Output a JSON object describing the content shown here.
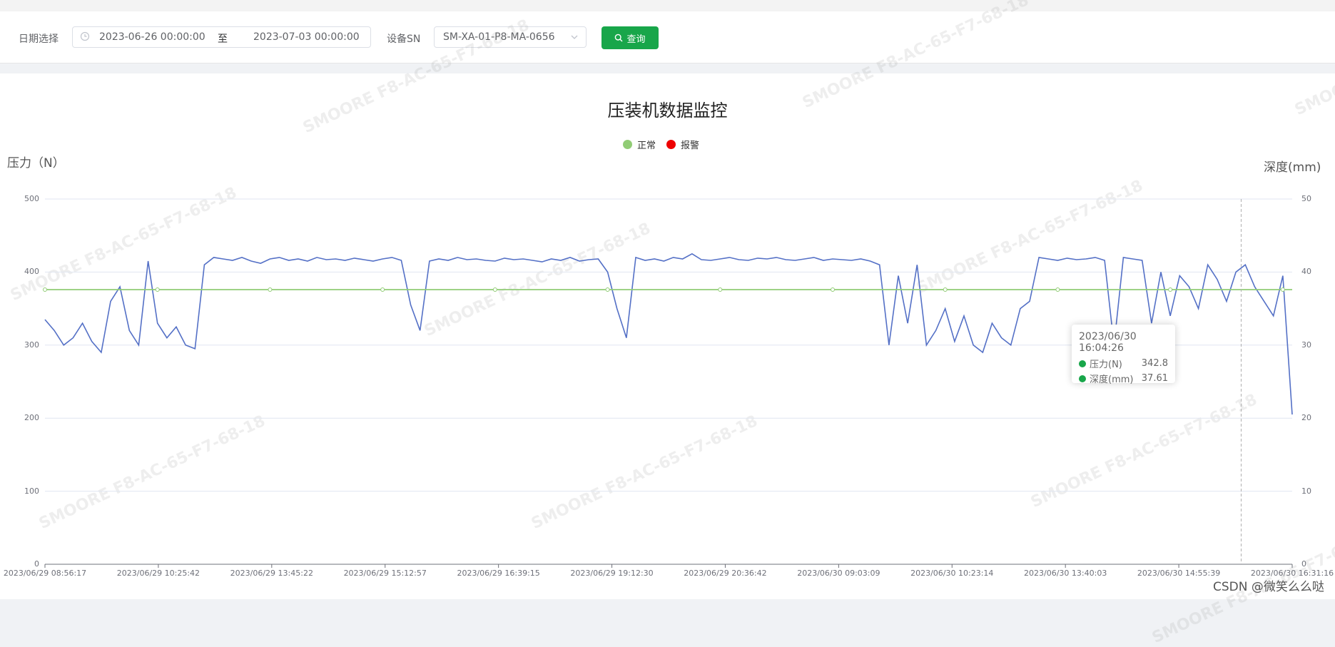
{
  "filter": {
    "date_label": "日期选择",
    "start_date": "2023-06-26 00:00:00",
    "range_separator": "至",
    "end_date": "2023-07-03 00:00:00",
    "sn_label": "设备SN",
    "sn_value": "SM-XA-01-P8-MA-0656",
    "query_label": "查询",
    "query_color": "#18a64a"
  },
  "watermark": {
    "text": "SMOORE  F8-AC-65-F7-68-18"
  },
  "tooltip": {
    "title": "2023/06/30 16:04:26",
    "rows": [
      {
        "name": "压力(N)",
        "value": "342.8"
      },
      {
        "name": "深度(mm)",
        "value": "37.61"
      }
    ]
  },
  "credit": "CSDN @微笑么么哒",
  "chart_data": {
    "type": "line",
    "title": "压装机数据监控",
    "legend": [
      {
        "name": "正常",
        "color": "#91cc75"
      },
      {
        "name": "报警",
        "color": "#ee0000"
      }
    ],
    "y_left": {
      "name": "压力（N）",
      "range": [
        0,
        500
      ],
      "ticks": [
        "0",
        "100",
        "200",
        "300",
        "400",
        "500"
      ]
    },
    "y_right": {
      "name": "深度(mm)",
      "range": [
        0,
        50
      ],
      "ticks": [
        "0",
        "10",
        "20",
        "30",
        "40",
        "50"
      ]
    },
    "x_tick_labels": [
      "2023/06/29 08:56:17",
      "2023/06/29 10:25:42",
      "2023/06/29 13:45:22",
      "2023/06/29 15:12:57",
      "2023/06/29 16:39:15",
      "2023/06/29 19:12:30",
      "2023/06/29 20:36:42",
      "2023/06/30 09:03:09",
      "2023/06/30 10:23:14",
      "2023/06/30 13:40:03",
      "2023/06/30 14:55:39",
      "2023/06/30 16:31:16"
    ],
    "grid": true,
    "series": [
      {
        "name": "压力(N)",
        "color": "#5470c6",
        "axis": "left",
        "values": [
          335,
          320,
          300,
          310,
          330,
          305,
          290,
          360,
          380,
          320,
          300,
          415,
          330,
          310,
          325,
          300,
          295,
          410,
          420,
          418,
          416,
          420,
          415,
          412,
          418,
          420,
          416,
          418,
          415,
          420,
          417,
          418,
          416,
          419,
          417,
          415,
          418,
          420,
          416,
          355,
          320,
          415,
          418,
          416,
          420,
          417,
          418,
          416,
          415,
          419,
          417,
          418,
          416,
          414,
          418,
          416,
          420,
          415,
          417,
          418,
          400,
          350,
          310,
          420,
          416,
          418,
          415,
          420,
          418,
          425,
          417,
          416,
          418,
          420,
          417,
          416,
          419,
          418,
          420,
          417,
          416,
          418,
          420,
          416,
          418,
          417,
          416,
          418,
          415,
          410,
          300,
          395,
          330,
          410,
          300,
          320,
          350,
          305,
          340,
          300,
          290,
          330,
          310,
          300,
          350,
          360,
          420,
          418,
          416,
          419,
          417,
          418,
          420,
          416,
          300,
          420,
          418,
          416,
          330,
          400,
          340,
          395,
          380,
          350,
          410,
          390,
          360,
          400,
          410,
          380,
          360,
          340,
          395,
          205
        ]
      },
      {
        "name": "深度(mm)",
        "color": "#91cc75",
        "axis": "right",
        "values": [
          37.6,
          37.6,
          37.6,
          37.6,
          37.6,
          37.6,
          37.6,
          37.6,
          37.6,
          37.6,
          37.6,
          37.6,
          37.6,
          37.6,
          37.6,
          37.6,
          37.6,
          37.6,
          37.6,
          37.6,
          37.6,
          37.6,
          37.6,
          37.6,
          37.6,
          37.6,
          37.6,
          37.6,
          37.6,
          37.6,
          37.6,
          37.6,
          37.6,
          37.6,
          37.6,
          37.6,
          37.6,
          37.6,
          37.6,
          37.6,
          37.6,
          37.6,
          37.6,
          37.6,
          37.6,
          37.6,
          37.6,
          37.6,
          37.6,
          37.6,
          37.6,
          37.6,
          37.6,
          37.6,
          37.6,
          37.6,
          37.6,
          37.6,
          37.6,
          37.6,
          37.6,
          37.6,
          37.6,
          37.6,
          37.6,
          37.6,
          37.6,
          37.6,
          37.6,
          37.6,
          37.6,
          37.6,
          37.6,
          37.6,
          37.6,
          37.6,
          37.6,
          37.6,
          37.6,
          37.6,
          37.6,
          37.6,
          37.6,
          37.6,
          37.6,
          37.6,
          37.6,
          37.6,
          37.6,
          37.6,
          37.6,
          37.6,
          37.6,
          37.6,
          37.6,
          37.6,
          37.6,
          37.6,
          37.6,
          37.6,
          37.6,
          37.6,
          37.6,
          37.6,
          37.6,
          37.6,
          37.6,
          37.6,
          37.6,
          37.6,
          37.6,
          37.6,
          37.6,
          37.6,
          37.6,
          37.6,
          37.6,
          37.6,
          37.6,
          37.6,
          37.6,
          37.6,
          37.6,
          37.6,
          37.6,
          37.6,
          37.6,
          37.6,
          37.6,
          37.6,
          37.6,
          37.6,
          37.6,
          37.6
        ]
      }
    ]
  }
}
